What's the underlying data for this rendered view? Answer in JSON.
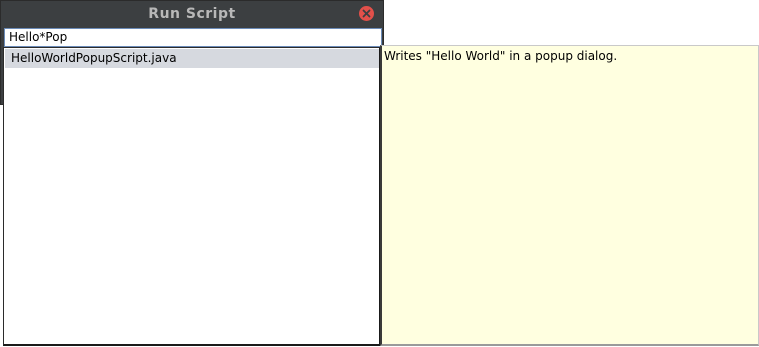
{
  "window": {
    "title": "Run Script"
  },
  "search": {
    "value": "Hello*Pop"
  },
  "results": {
    "items": [
      {
        "label": "HelloWorldPopupScript.java"
      }
    ]
  },
  "description": {
    "text": "Writes \"Hello World\" in a popup dialog."
  },
  "colors": {
    "titlebar": "#3c3f41",
    "close_button": "#e2504a",
    "selection": "#d6d9df",
    "description_background": "#ffffe0"
  },
  "icons": {
    "close": "close-icon"
  }
}
